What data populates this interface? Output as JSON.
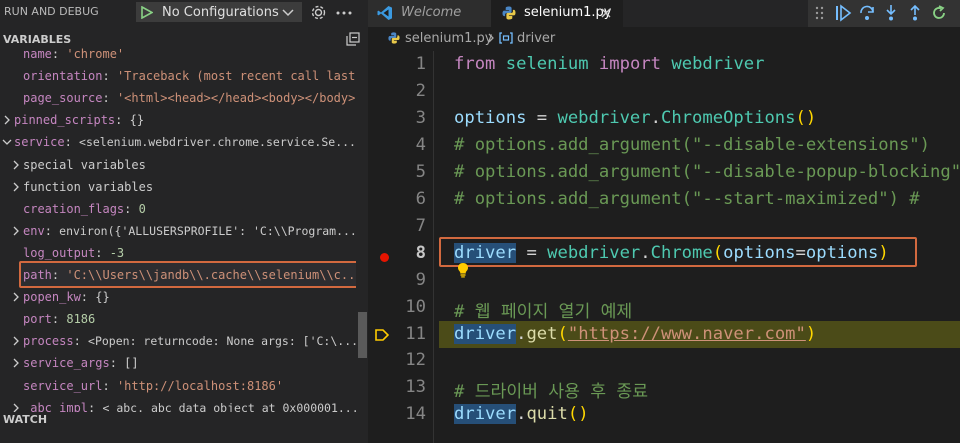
{
  "debug_panel": {
    "title": "RUN AND DEBUG",
    "configuration": "No Configurations",
    "variables_title": "VARIABLES",
    "watch_title": "WATCH",
    "variables": [
      {
        "expandable": false,
        "indent": 1,
        "name": "name",
        "value": "'chrome'",
        "vtype": "s"
      },
      {
        "expandable": false,
        "indent": 1,
        "name": "orientation",
        "value": "'Traceback (most recent call last...",
        "vtype": "s"
      },
      {
        "expandable": false,
        "indent": 1,
        "name": "page_source",
        "value": "'<html><head></head><body></body>...",
        "vtype": "s"
      },
      {
        "expandable": true,
        "indent": 0,
        "name": "pinned_scripts",
        "value": "{}",
        "vtype": "p"
      },
      {
        "expandable": true,
        "expanded": true,
        "indent": 0,
        "name": "service",
        "value": "<selenium.webdriver.chrome.service.Se...",
        "vtype": "o"
      },
      {
        "expandable": true,
        "indent": 1,
        "name": "special variables",
        "value": "",
        "vtype": "p"
      },
      {
        "expandable": true,
        "indent": 1,
        "name": "function variables",
        "value": "",
        "vtype": "p"
      },
      {
        "expandable": false,
        "indent": 1,
        "name": "creation_flags",
        "value": "0",
        "vtype": "n"
      },
      {
        "expandable": true,
        "indent": 1,
        "name": "env",
        "value": "environ({'ALLUSERSPROFILE': 'C:\\\\Program...",
        "vtype": "o"
      },
      {
        "expandable": false,
        "indent": 1,
        "name": "log_output",
        "value": "-3",
        "vtype": "n"
      },
      {
        "expandable": false,
        "indent": 1,
        "name": "path",
        "value": "'C:\\\\Users\\\\jandb\\\\.cache\\\\selenium\\\\c...",
        "vtype": "s"
      },
      {
        "expandable": true,
        "indent": 1,
        "name": "popen_kw",
        "value": "{}",
        "vtype": "p"
      },
      {
        "expandable": false,
        "indent": 1,
        "name": "port",
        "value": "8186",
        "vtype": "n"
      },
      {
        "expandable": true,
        "indent": 1,
        "name": "process",
        "value": "<Popen: returncode: None args: ['C:\\...",
        "vtype": "o"
      },
      {
        "expandable": true,
        "indent": 1,
        "name": "service_args",
        "value": "[]",
        "vtype": "p"
      },
      {
        "expandable": false,
        "indent": 1,
        "name": "service_url",
        "value": "'http://localhost:8186'",
        "vtype": "s"
      },
      {
        "expandable": true,
        "indent": 1,
        "name": "_abc_impl",
        "value": "<_abc._abc_data object at 0x000001...",
        "vtype": "o"
      }
    ]
  },
  "editor": {
    "tabs": [
      {
        "label": "Welcome",
        "active": false
      },
      {
        "label": "selenium1.py",
        "active": true
      }
    ],
    "breadcrumb": {
      "file": "selenium1.py",
      "symbol": "driver"
    },
    "colors": {
      "breakpoint": "#e51400",
      "highlight_border": "#d2693f",
      "current_line": "#4b4b18"
    },
    "lines": [
      {
        "num": "1",
        "tokens": [
          [
            "kw",
            "from"
          ],
          [
            "pn",
            " "
          ],
          [
            "id",
            "selenium"
          ],
          [
            "pn",
            " "
          ],
          [
            "kw",
            "import"
          ],
          [
            "pn",
            " "
          ],
          [
            "id",
            "webdriver"
          ]
        ]
      },
      {
        "num": "2",
        "tokens": []
      },
      {
        "num": "3",
        "tokens": [
          [
            "var",
            "options"
          ],
          [
            "pn",
            " = "
          ],
          [
            "id",
            "webdriver"
          ],
          [
            "pn",
            "."
          ],
          [
            "id",
            "ChromeOptions"
          ],
          [
            "par",
            "()"
          ]
        ]
      },
      {
        "num": "4",
        "tokens": [
          [
            "cm",
            "# options.add_argument(\"--disable-extensions\")"
          ]
        ]
      },
      {
        "num": "5",
        "tokens": [
          [
            "cm",
            "# options.add_argument(\"--disable-popup-blocking\")"
          ]
        ]
      },
      {
        "num": "6",
        "tokens": [
          [
            "cm",
            "# options.add_argument(\"--start-maximized\")  # "
          ]
        ]
      },
      {
        "num": "7",
        "tokens": []
      },
      {
        "num": "8",
        "tokens": [
          [
            "var hlword",
            "driver"
          ],
          [
            "pn",
            " = "
          ],
          [
            "id",
            "webdriver"
          ],
          [
            "pn",
            "."
          ],
          [
            "id",
            "Chrome"
          ],
          [
            "par",
            "("
          ],
          [
            "var",
            "options"
          ],
          [
            "pn",
            "="
          ],
          [
            "var",
            "options"
          ],
          [
            "par",
            ")"
          ]
        ]
      },
      {
        "num": "9",
        "tokens": []
      },
      {
        "num": "10",
        "tokens": [
          [
            "cm",
            "# 웹 페이지 열기 예제"
          ]
        ]
      },
      {
        "num": "11",
        "tokens": [
          [
            "var hlword",
            "driver"
          ],
          [
            "pn",
            "."
          ],
          [
            "fn",
            "get"
          ],
          [
            "par",
            "("
          ],
          [
            "str url",
            "\"https://www.naver.com\""
          ],
          [
            "par",
            ")"
          ]
        ]
      },
      {
        "num": "12",
        "tokens": []
      },
      {
        "num": "13",
        "tokens": [
          [
            "cm",
            "# 드라이버 사용 후 종료"
          ]
        ]
      },
      {
        "num": "14",
        "tokens": [
          [
            "var hlword",
            "driver"
          ],
          [
            "pn",
            "."
          ],
          [
            "fn",
            "quit"
          ],
          [
            "par",
            "()"
          ]
        ]
      }
    ]
  }
}
